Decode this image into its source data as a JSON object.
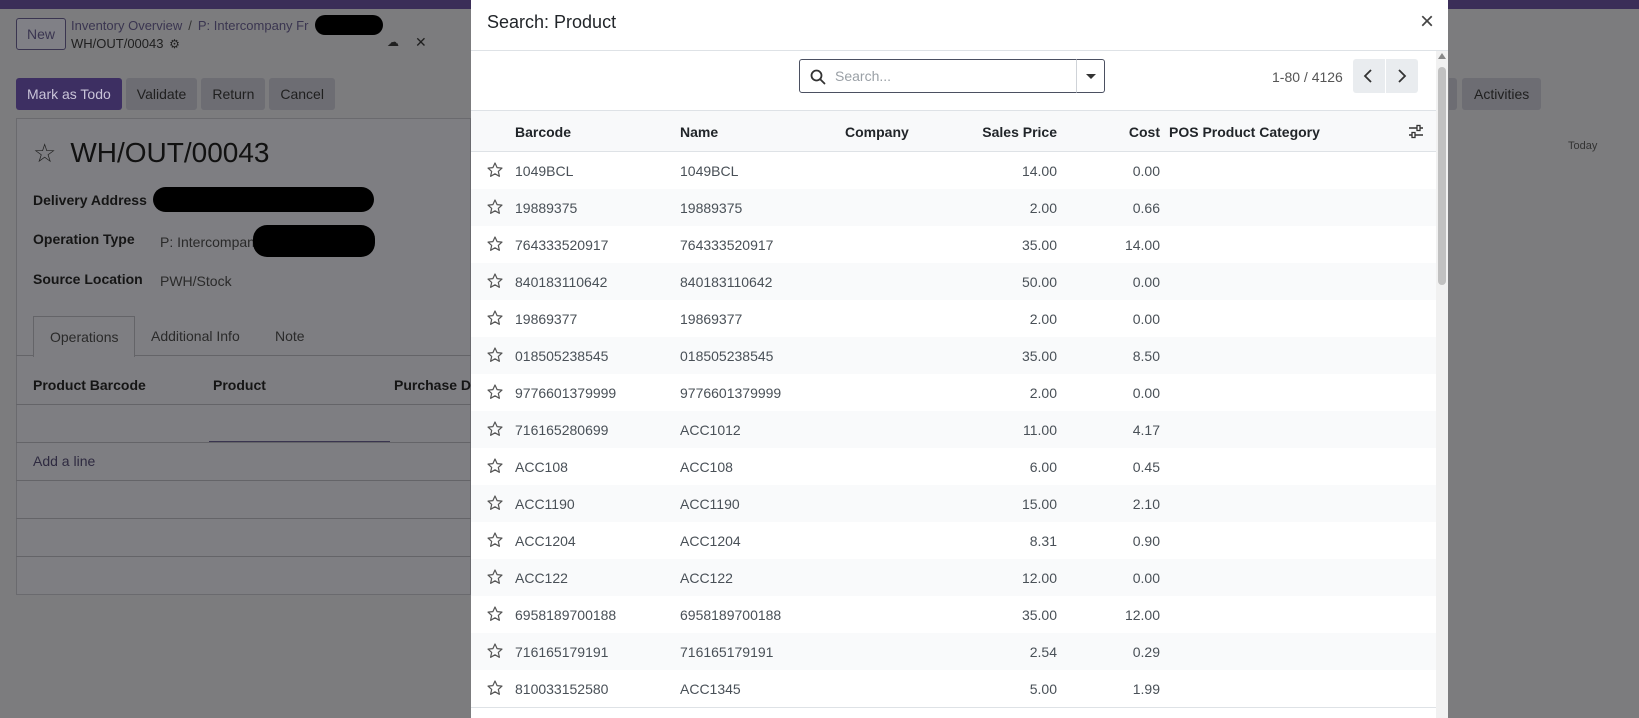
{
  "background": {
    "new_button": "New",
    "breadcrumb": {
      "parent": "Inventory Overview",
      "separator": "/",
      "current": "P: Intercompany Fr",
      "record": "WH/OUT/00043"
    },
    "actions": [
      "Mark as Todo",
      "Validate",
      "Return",
      "Cancel"
    ],
    "activities_label": "Activities",
    "today_label": "Today",
    "record_title": "WH/OUT/00043",
    "fields": [
      {
        "label": "Delivery Address",
        "value": ""
      },
      {
        "label": "Operation Type",
        "value": "P: Intercompany"
      },
      {
        "label": "Source Location",
        "value": "PWH/Stock"
      }
    ],
    "tabs": [
      "Operations",
      "Additional Info",
      "Note"
    ],
    "columns": [
      "Product Barcode",
      "Product",
      "Purchase De"
    ],
    "add_line": "Add a line"
  },
  "modal": {
    "title": "Search: Product",
    "search": {
      "placeholder": "Search...",
      "value": ""
    },
    "pager": {
      "value": "1-80 / 4126"
    },
    "columns": {
      "barcode": "Barcode",
      "name": "Name",
      "company": "Company",
      "sales_price": "Sales Price",
      "cost": "Cost",
      "pos_category": "POS Product Category"
    },
    "rows": [
      {
        "barcode": "1049BCL",
        "name": "1049BCL",
        "company": "",
        "sales_price": "14.00",
        "cost": "0.00",
        "pos_category": ""
      },
      {
        "barcode": "19889375",
        "name": "19889375",
        "company": "",
        "sales_price": "2.00",
        "cost": "0.66",
        "pos_category": ""
      },
      {
        "barcode": "764333520917",
        "name": "764333520917",
        "company": "",
        "sales_price": "35.00",
        "cost": "14.00",
        "pos_category": ""
      },
      {
        "barcode": "840183110642",
        "name": "840183110642",
        "company": "",
        "sales_price": "50.00",
        "cost": "0.00",
        "pos_category": ""
      },
      {
        "barcode": "19869377",
        "name": "19869377",
        "company": "",
        "sales_price": "2.00",
        "cost": "0.00",
        "pos_category": ""
      },
      {
        "barcode": "018505238545",
        "name": "018505238545",
        "company": "",
        "sales_price": "35.00",
        "cost": "8.50",
        "pos_category": ""
      },
      {
        "barcode": "9776601379999",
        "name": "9776601379999",
        "company": "",
        "sales_price": "2.00",
        "cost": "0.00",
        "pos_category": ""
      },
      {
        "barcode": "716165280699",
        "name": "ACC1012",
        "company": "",
        "sales_price": "11.00",
        "cost": "4.17",
        "pos_category": ""
      },
      {
        "barcode": "ACC108",
        "name": "ACC108",
        "company": "",
        "sales_price": "6.00",
        "cost": "0.45",
        "pos_category": ""
      },
      {
        "barcode": "ACC1190",
        "name": "ACC1190",
        "company": "",
        "sales_price": "15.00",
        "cost": "2.10",
        "pos_category": ""
      },
      {
        "barcode": "ACC1204",
        "name": "ACC1204",
        "company": "",
        "sales_price": "8.31",
        "cost": "0.90",
        "pos_category": ""
      },
      {
        "barcode": "ACC122",
        "name": "ACC122",
        "company": "",
        "sales_price": "12.00",
        "cost": "0.00",
        "pos_category": ""
      },
      {
        "barcode": "6958189700188",
        "name": "6958189700188",
        "company": "",
        "sales_price": "35.00",
        "cost": "12.00",
        "pos_category": ""
      },
      {
        "barcode": "716165179191",
        "name": "716165179191",
        "company": "",
        "sales_price": "2.54",
        "cost": "0.29",
        "pos_category": ""
      },
      {
        "barcode": "810033152580",
        "name": "ACC1345",
        "company": "",
        "sales_price": "5.00",
        "cost": "1.99",
        "pos_category": ""
      }
    ]
  },
  "colors": {
    "brand": "#714b67",
    "topbar": "#3b2e58",
    "overlay": "#7c7c7e",
    "modal_bg": "#ffffff",
    "border": "#dee2e6"
  },
  "icons": [
    "close-icon",
    "search-icon",
    "caret-down-icon",
    "chevron-left-icon",
    "chevron-right-icon",
    "sliders-icon",
    "star-icon",
    "gear-icon",
    "cloud-upload-icon",
    "discard-icon"
  ]
}
